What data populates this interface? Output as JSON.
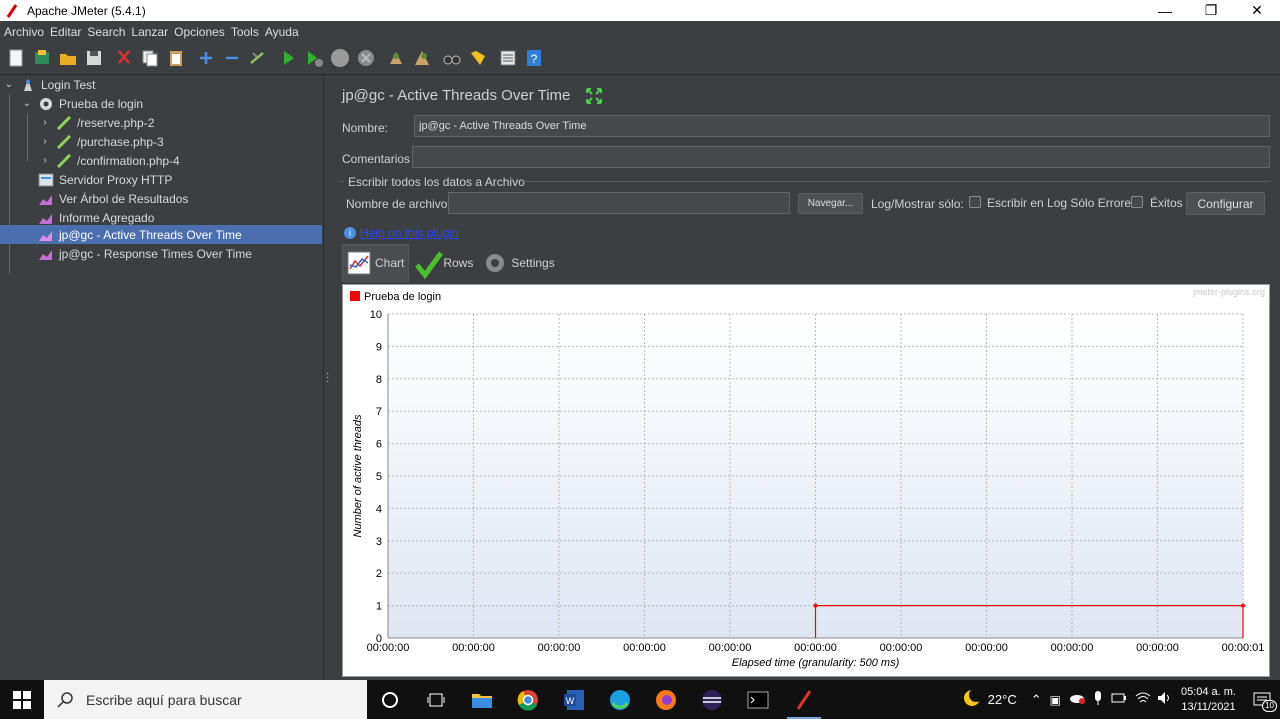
{
  "window": {
    "title": "Apache JMeter (5.4.1)",
    "min": "—",
    "max": "❐",
    "close": "✕"
  },
  "menu": [
    "Archivo",
    "Editar",
    "Search",
    "Lanzar",
    "Opciones",
    "Tools",
    "Ayuda"
  ],
  "tree": {
    "root": "Login Test",
    "thread_group": "Prueba de login",
    "items": [
      "/reserve.php-2",
      "/purchase.php-3",
      "/confirmation.php-4",
      "Servidor Proxy HTTP",
      "Ver Árbol de Resultados",
      "Informe Agregado",
      "jp@gc - Active Threads Over Time",
      "jp@gc - Response Times Over Time"
    ]
  },
  "panel": {
    "title": "jp@gc - Active Threads Over Time",
    "name_label": "Nombre:",
    "name_value": "jp@gc - Active Threads Over Time",
    "comments_label": "Comentarios",
    "comments_value": "",
    "write_group": "Escribir todos los datos a Archivo",
    "filename_label": "Nombre de archivo",
    "filename_value": "",
    "browse_button": "Navegar...",
    "log_show_label": "Log/Mostrar sólo:",
    "errors_only_label": "Escribir en Log Sólo Errores",
    "success_label": "Éxitos",
    "configure_button": "Configurar",
    "help_link": "Help on this plugin",
    "tabs": [
      "Chart",
      "Rows",
      "Settings"
    ]
  },
  "chart_data": {
    "type": "line",
    "watermark": "jmeter-plugins.org",
    "legend": "Prueba de login",
    "legend_position": "top-left",
    "ylabel": "Number of active threads",
    "xlabel": "Elapsed time (granularity: 500 ms)",
    "y_ticks": [
      "0",
      "1",
      "2",
      "3",
      "4",
      "5",
      "6",
      "7",
      "8",
      "9",
      "10"
    ],
    "ylim": [
      0,
      10
    ],
    "x_ticks": [
      "00:00:00",
      "00:00:00",
      "00:00:00",
      "00:00:00",
      "00:00:00",
      "00:00:00",
      "00:00:00",
      "00:00:00",
      "00:00:00",
      "00:00:00",
      "00:00:01"
    ],
    "grid": true,
    "series": [
      {
        "name": "Prueba de login",
        "color": "#ff0000",
        "points": [
          [
            5,
            0
          ],
          [
            5,
            1
          ],
          [
            10,
            1
          ],
          [
            10,
            0
          ]
        ]
      }
    ]
  },
  "taskbar": {
    "search_placeholder": "Escribe aquí para buscar",
    "weather": "22°C",
    "time": "05:04 a. m.",
    "date": "13/11/2021",
    "notifications": "10"
  }
}
